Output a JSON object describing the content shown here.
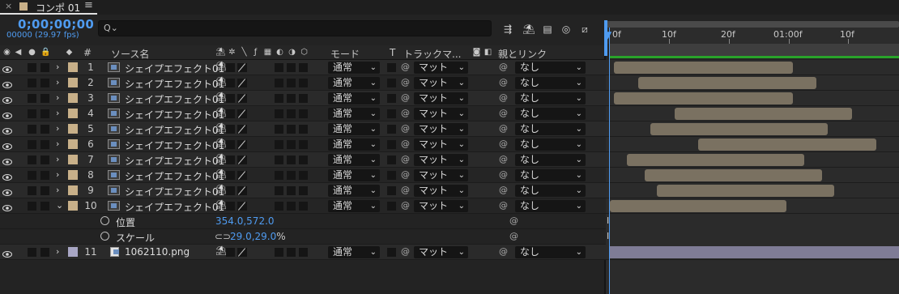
{
  "tab": {
    "close": "×",
    "title": "コンポ 01",
    "menu": "≡"
  },
  "header": {
    "timecode": "0;00;00;00",
    "frames": "00000 (29.97 fps)",
    "search_icon": "Q⌄",
    "search_placeholder": ""
  },
  "columns": {
    "num": "#",
    "source": "ソース名",
    "mode": "モード",
    "t": "T",
    "track": "トラックマ...",
    "parent": "親とリンク"
  },
  "timeline": {
    "ticks": [
      "0f",
      "10f",
      "20f",
      "01:00f",
      "10f"
    ]
  },
  "layers": [
    {
      "num": "1",
      "name": "シェイプエフェクト01",
      "mode": "通常",
      "track": "マット",
      "parent": "なし",
      "expanded": false,
      "color": "#c8b089"
    },
    {
      "num": "2",
      "name": "シェイプエフェクト01",
      "mode": "通常",
      "track": "マット",
      "parent": "なし",
      "expanded": false,
      "color": "#c8b089"
    },
    {
      "num": "3",
      "name": "シェイプエフェクト01",
      "mode": "通常",
      "track": "マット",
      "parent": "なし",
      "expanded": false,
      "color": "#c8b089"
    },
    {
      "num": "4",
      "name": "シェイプエフェクト01",
      "mode": "通常",
      "track": "マット",
      "parent": "なし",
      "expanded": false,
      "color": "#c8b089"
    },
    {
      "num": "5",
      "name": "シェイプエフェクト01",
      "mode": "通常",
      "track": "マット",
      "parent": "なし",
      "expanded": false,
      "color": "#c8b089"
    },
    {
      "num": "6",
      "name": "シェイプエフェクト01",
      "mode": "通常",
      "track": "マット",
      "parent": "なし",
      "expanded": false,
      "color": "#c8b089"
    },
    {
      "num": "7",
      "name": "シェイプエフェクト01",
      "mode": "通常",
      "track": "マット",
      "parent": "なし",
      "expanded": false,
      "color": "#c8b089"
    },
    {
      "num": "8",
      "name": "シェイプエフェクト01",
      "mode": "通常",
      "track": "マット",
      "parent": "なし",
      "expanded": false,
      "color": "#c8b089"
    },
    {
      "num": "9",
      "name": "シェイプエフェクト01",
      "mode": "通常",
      "track": "マット",
      "parent": "なし",
      "expanded": false,
      "color": "#c8b089"
    },
    {
      "num": "10",
      "name": "シェイプエフェクト01",
      "mode": "通常",
      "track": "マット",
      "parent": "なし",
      "expanded": true,
      "color": "#c8b089"
    }
  ],
  "properties": {
    "position": {
      "label": "位置",
      "value": "354.0,572.0"
    },
    "scale": {
      "label": "スケール",
      "value": "29.0,29.0",
      "unit": "%"
    }
  },
  "layer11": {
    "num": "11",
    "name": "1062110.png",
    "mode": "通常",
    "track": "マット",
    "parent": "なし",
    "color": "#a8a6c4"
  },
  "colors": {
    "accent": "#4f9bf0",
    "clip": "#7a7161",
    "clip_png": "#7f7c96",
    "work_area_bar": "#29a32a"
  }
}
